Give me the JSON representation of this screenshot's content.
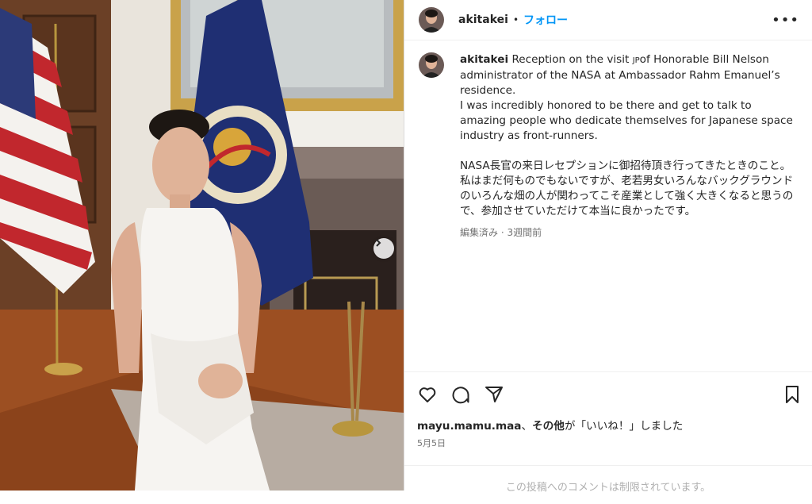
{
  "post": {
    "username": "akitakei",
    "separator": "•",
    "follow_label": "フォロー",
    "more_icon": "more-horizontal-icon",
    "caption_en_1": "Reception on the visit ",
    "caption_flag": "JP",
    "caption_en_2": "of Honorable Bill Nelson administrator of the NASA at Ambassador Rahm Emanuel’s residence.",
    "caption_en_3": "I was incredibly honored to be there and get to talk to amazing people who dedicate themselves for Japanese space industry as front-runners.",
    "caption_jp": "NASA長官の来日レセプションに御招待頂き行ってきたときのこと。私はまだ何ものでもないですが、老若男女いろんなバックグラウンドのいろんな畑の人が関わってこそ産業として強く大きくなると思うので、参加させていただけて本当に良かったです。",
    "caption_meta": "編集済み · 3週間前",
    "likes_user": "mayu.mamu.maa",
    "likes_text_1": "、",
    "likes_other": "その他",
    "likes_text_2": "が「いいね！」しました",
    "date": "5月5日",
    "comments_disabled": "この投稿へのコメントは制限されています。"
  },
  "icons": [
    "heart-icon",
    "comment-icon",
    "share-icon",
    "bookmark-icon",
    "chevron-right-icon"
  ]
}
